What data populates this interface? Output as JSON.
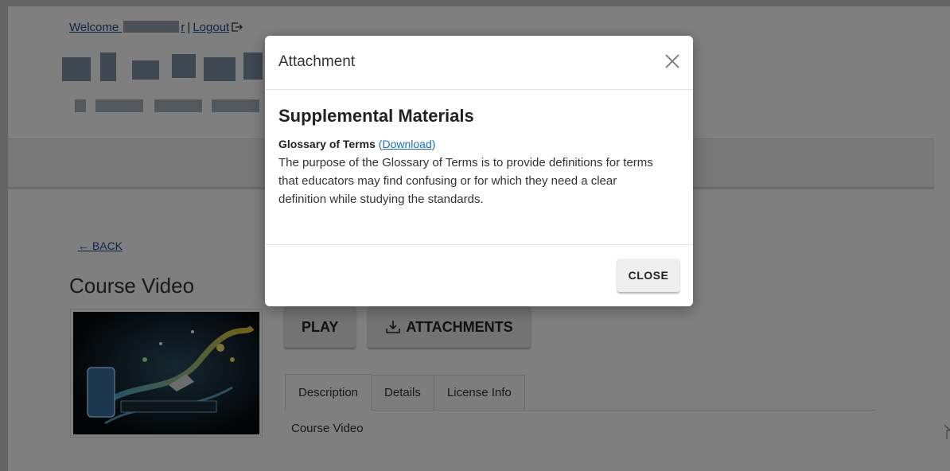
{
  "header": {
    "welcome_prefix": "Welcome ",
    "welcome_suffix": "r",
    "logout_label": "Logout",
    "separator": "|"
  },
  "back": {
    "label": "← BACK"
  },
  "course": {
    "title": "Course Video"
  },
  "actions": {
    "play_label": "PLAY",
    "attachments_label": "ATTACHMENTS"
  },
  "tabs": [
    {
      "label": "Description",
      "active": true
    },
    {
      "label": "Details",
      "active": false
    },
    {
      "label": "License Info",
      "active": false
    }
  ],
  "tab_content": {
    "text": "Course Video"
  },
  "modal": {
    "title": "Attachment",
    "heading": "Supplemental Materials",
    "item_name": "Glossary of Terms",
    "link_open": " (",
    "link_label": "Download",
    "link_close": ")",
    "description": "The purpose of the Glossary of Terms is to provide definitions for terms that educators may find confusing or for which they need a clear definition while studying the standards.",
    "close_label": "CLOSE"
  },
  "colors": {
    "link": "#1a4f8b",
    "overlay": "rgba(0,0,0,0.5)",
    "modal_bg": "#ffffff"
  }
}
